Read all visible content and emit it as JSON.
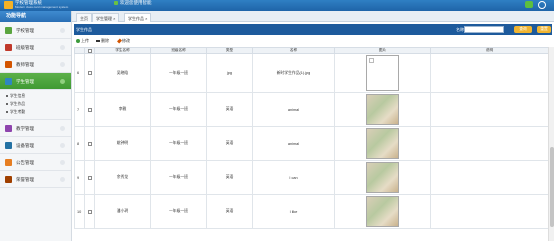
{
  "header": {
    "brand": "学校管理系统",
    "brand_sub": "Modern class card management system",
    "welcome": "欢迎您使用智能"
  },
  "sidebar": {
    "title": "功能导航",
    "items": [
      {
        "label": "学校管理",
        "icon": "tree-icon",
        "color": "#5aa53f"
      },
      {
        "label": "班级管理",
        "icon": "class-icon",
        "color": "#c0392b"
      },
      {
        "label": "教师管理",
        "icon": "teacher-icon",
        "color": "#d35400"
      },
      {
        "label": "学生管理",
        "icon": "student-icon",
        "color": "#2e86c1",
        "active": true,
        "subitems": [
          "学生信息",
          "学生作品",
          "学生考勤"
        ]
      },
      {
        "label": "教学管理",
        "icon": "teaching-icon",
        "color": "#8e44ad"
      },
      {
        "label": "设备管理",
        "icon": "device-icon",
        "color": "#2471a3"
      },
      {
        "label": "公告管理",
        "icon": "notice-icon",
        "color": "#e67e22"
      },
      {
        "label": "荣誉管理",
        "icon": "honor-icon",
        "color": "#a04000"
      }
    ]
  },
  "tabs": [
    {
      "label": "主页"
    },
    {
      "label": "学生管理 ×"
    },
    {
      "label": "学生作品 ×",
      "active": true
    }
  ],
  "panel": {
    "title": "学生作品",
    "name_label": "名称",
    "search_label": "查询",
    "reset_label": "重置"
  },
  "toolbar": {
    "add": "上传",
    "delete": "删除",
    "edit": "修改"
  },
  "table": {
    "columns": [
      "",
      "",
      "学生名称",
      "班级名称",
      "类型",
      "名称",
      "图片",
      "说明"
    ],
    "rows": [
      {
        "no": "6",
        "student": "吴晓晗",
        "class": "一年级一班",
        "type": "jpg",
        "name": "新时学生作品(1).jpg",
        "image": "blank"
      },
      {
        "no": "7",
        "student": "李雅",
        "class": "一年级一班",
        "type": "英语",
        "name": "animal",
        "image": "photo"
      },
      {
        "no": "8",
        "student": "姚钟明",
        "class": "一年级一班",
        "type": "英语",
        "name": "animal",
        "image": "photo"
      },
      {
        "no": "9",
        "student": "余秀龙",
        "class": "一年级一班",
        "type": "英语",
        "name": "I can",
        "image": "photo"
      },
      {
        "no": "10",
        "student": "潘小玥",
        "class": "一年级一班",
        "type": "英语",
        "name": "I like",
        "image": "photo"
      }
    ]
  }
}
